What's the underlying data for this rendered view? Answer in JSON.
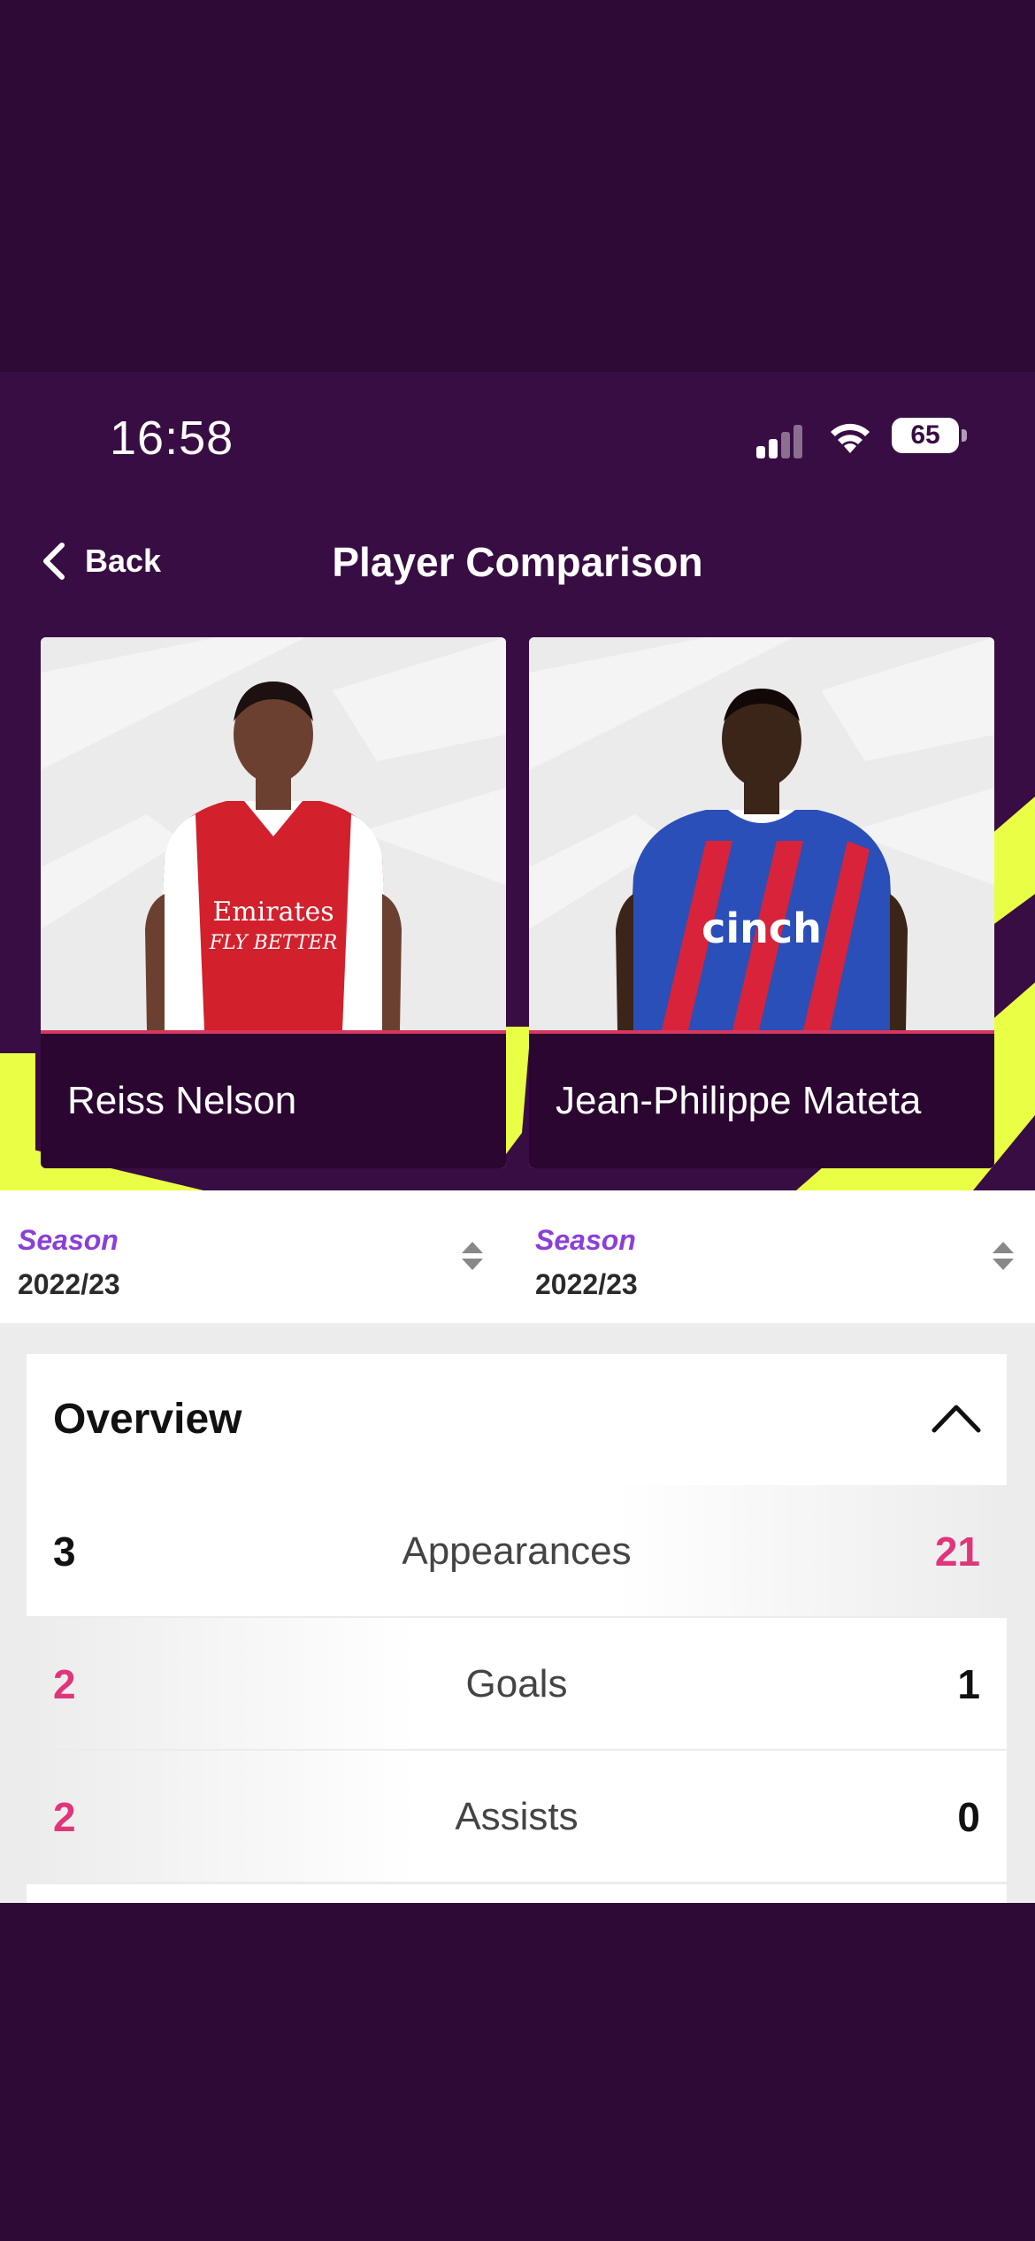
{
  "status_bar": {
    "time": "16:58",
    "battery": "65"
  },
  "nav": {
    "back_label": "Back",
    "title": "Player Comparison"
  },
  "players": [
    {
      "name": "Reiss Nelson",
      "kit_color": "#d2202c",
      "sponsor": "Emirates FLY BETTER"
    },
    {
      "name": "Jean-Philippe Mateta",
      "kit_color": "#2a4fb8",
      "sponsor": "cinch"
    }
  ],
  "seasons": [
    {
      "label": "Season",
      "value": "2022/23"
    },
    {
      "label": "Season",
      "value": "2022/23"
    }
  ],
  "overview": {
    "title": "Overview",
    "expanded": true,
    "rows": [
      {
        "label": "Appearances",
        "left": "3",
        "right": "21",
        "leader": "right"
      },
      {
        "label": "Goals",
        "left": "2",
        "right": "1",
        "leader": "left"
      },
      {
        "label": "Assists",
        "left": "2",
        "right": "0",
        "leader": "left"
      }
    ]
  },
  "colors": {
    "background": "#380d43",
    "accent_yellow": "#e9ff45",
    "highlight": "#e0357a",
    "season_label": "#8b3fd9"
  }
}
